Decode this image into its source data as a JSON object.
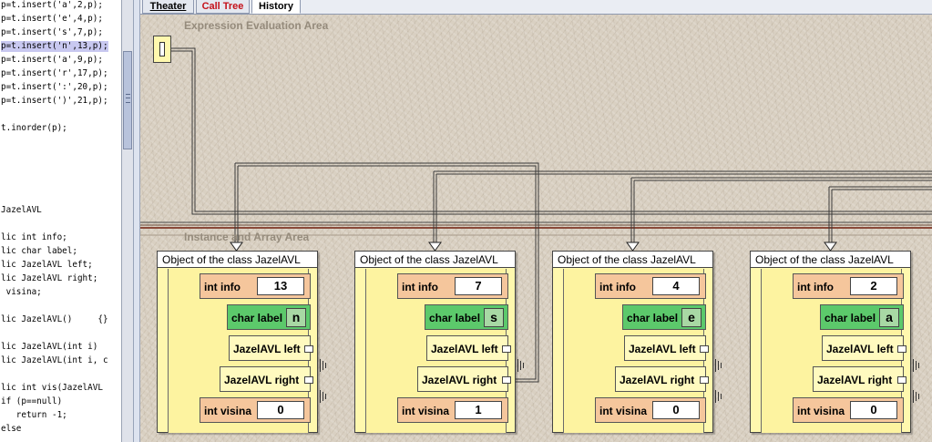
{
  "code_lines": [
    {
      "text": "p=t.insert('a',2,p);",
      "highlight": false
    },
    {
      "text": "p=t.insert('e',4,p);",
      "highlight": false
    },
    {
      "text": "p=t.insert('s',7,p);",
      "highlight": false
    },
    {
      "text": "p=t.insert('n',13,p);",
      "highlight": true
    },
    {
      "text": "p=t.insert('a',9,p);",
      "highlight": false
    },
    {
      "text": "p=t.insert('r',17,p);",
      "highlight": false
    },
    {
      "text": "p=t.insert(':',20,p);",
      "highlight": false
    },
    {
      "text": "p=t.insert(')',21,p);",
      "highlight": false
    },
    {
      "text": "",
      "highlight": false
    },
    {
      "text": "t.inorder(p);",
      "highlight": false
    },
    {
      "text": "",
      "highlight": false
    },
    {
      "text": "",
      "highlight": false
    },
    {
      "text": "",
      "highlight": false
    },
    {
      "text": "",
      "highlight": false
    },
    {
      "text": "",
      "highlight": false
    },
    {
      "text": "JazelAVL",
      "highlight": false
    },
    {
      "text": "",
      "highlight": false
    },
    {
      "text": "lic int info;",
      "highlight": false
    },
    {
      "text": "lic char label;",
      "highlight": false
    },
    {
      "text": "lic JazelAVL left;",
      "highlight": false
    },
    {
      "text": "lic JazelAVL right;",
      "highlight": false
    },
    {
      "text": " visina;",
      "highlight": false
    },
    {
      "text": "",
      "highlight": false
    },
    {
      "text": "lic JazelAVL()     {}",
      "highlight": false
    },
    {
      "text": "",
      "highlight": false
    },
    {
      "text": "lic JazelAVL(int i)",
      "highlight": false
    },
    {
      "text": "lic JazelAVL(int i, c",
      "highlight": false
    },
    {
      "text": "",
      "highlight": false
    },
    {
      "text": "lic int vis(JazelAVL",
      "highlight": false
    },
    {
      "text": "if (p==null)",
      "highlight": false
    },
    {
      "text": "   return -1;",
      "highlight": false
    },
    {
      "text": "else",
      "highlight": false
    }
  ],
  "tabs": {
    "theater": "Theater",
    "call_tree": "Call Tree",
    "history": "History"
  },
  "areas": {
    "expression": "Expression Evaluation Area",
    "instance": "Instance and Array Area"
  },
  "objects": [
    {
      "title": "Object of the class JazelAVL",
      "info_label": "int info",
      "info": "13",
      "label_label": "char label",
      "label": "n",
      "left_label": "JazelAVL left",
      "right_label": "JazelAVL right",
      "visina_label": "int visina",
      "visina": "0"
    },
    {
      "title": "Object of the class JazelAVL",
      "info_label": "int info",
      "info": "7",
      "label_label": "char label",
      "label": "s",
      "left_label": "JazelAVL left",
      "right_label": "JazelAVL right",
      "visina_label": "int visina",
      "visina": "1"
    },
    {
      "title": "Object of the class JazelAVL",
      "info_label": "int info",
      "info": "4",
      "label_label": "char label",
      "label": "e",
      "left_label": "JazelAVL left",
      "right_label": "JazelAVL right",
      "visina_label": "int visina",
      "visina": "0"
    },
    {
      "title": "Object of the class JazelAVL",
      "info_label": "int info",
      "info": "2",
      "label_label": "char label",
      "label": "a",
      "left_label": "JazelAVL left",
      "right_label": "JazelAVL right",
      "visina_label": "int visina",
      "visina": "0"
    }
  ],
  "colors": {
    "code_highlight": "#c8c8f0",
    "int_field": "#f5c69c",
    "char_field": "#5cc96b",
    "object_body": "#fff8ae",
    "call_tree_tab": "#c4111a"
  }
}
